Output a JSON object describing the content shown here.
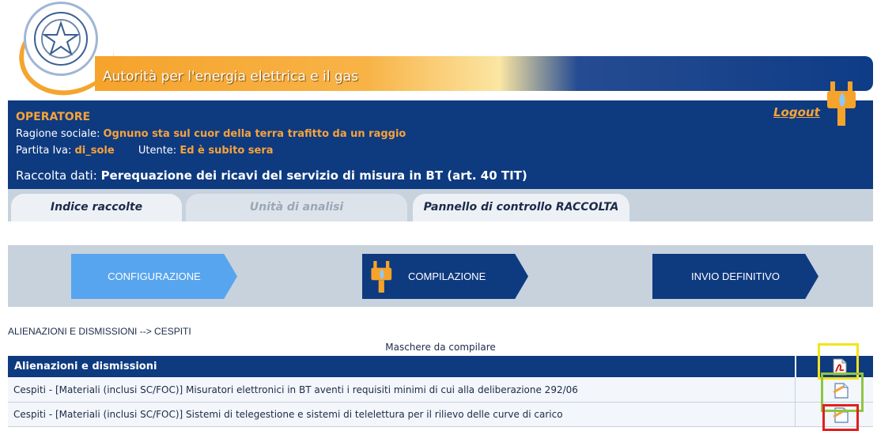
{
  "header": {
    "authority_title": "Autorità per l'energia elettrica e il gas"
  },
  "operator": {
    "heading": "OPERATORE",
    "ragione_label": "Ragione sociale:",
    "ragione_value": "Ognuno sta sul cuor della terra trafitto da un raggio",
    "piva_label": "Partita Iva:",
    "piva_value": "di_sole",
    "utente_label": "Utente:",
    "utente_value": "Ed è subito sera",
    "logout": "Logout",
    "raccolta_label": "Raccolta dati:",
    "raccolta_value": "Perequazione dei ricavi del servizio di misura in BT (art. 40 TIT)"
  },
  "tabs": [
    {
      "label": "Indice raccolte"
    },
    {
      "label": "Unità di analisi"
    },
    {
      "label": "Pannello di controllo RACCOLTA"
    }
  ],
  "steps": [
    {
      "label": "CONFIGURAZIONE"
    },
    {
      "label": "COMPILAZIONE"
    },
    {
      "label": "INVIO DEFINITIVO"
    }
  ],
  "breadcrumb": "ALIENAZIONI E DISMISSIONI --> CESPITI",
  "subtitle": "Maschere da compilare",
  "table": {
    "header": "Alienazioni e dismissioni",
    "rows": [
      {
        "label": "Cespiti - [Materiali (inclusi SC/FOC)] Misuratori elettronici in BT aventi i requisiti minimi di cui alla deliberazione 292/06"
      },
      {
        "label": "Cespiti - [Materiali (inclusi SC/FOC)] Sistemi di telegestione e sistemi di telelettura per il rilievo delle curve di carico"
      }
    ]
  },
  "colors": {
    "navy": "#0e3a80",
    "orange": "#f7a33a",
    "active_step": "#57a5ee",
    "highlight_yellow": "#f5e31a",
    "highlight_green": "#8ec641",
    "highlight_red": "#e21f1f"
  },
  "icons": {
    "emblem": "republic-emblem-icon",
    "plug": "plug-icon",
    "pdf": "pdf-icon",
    "edit": "edit-document-icon"
  }
}
